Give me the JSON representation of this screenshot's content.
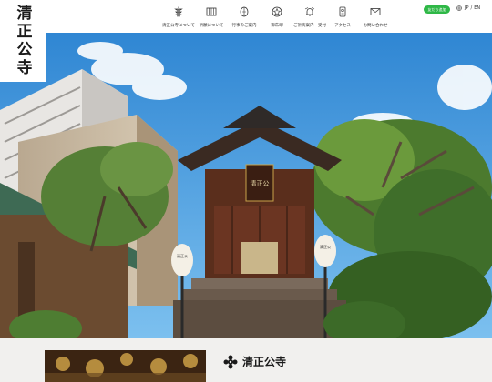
{
  "site": {
    "logo_text": "清正公寺"
  },
  "nav": {
    "items": [
      {
        "label": "清正公寺について",
        "icon": "pagoda-icon"
      },
      {
        "label": "祈願について",
        "icon": "prayer-book-icon"
      },
      {
        "label": "行事のご案内",
        "icon": "lantern-icon"
      },
      {
        "label": "御朱印",
        "icon": "seal-icon"
      },
      {
        "label": "ご祈祷案内・受付",
        "icon": "bell-icon"
      },
      {
        "label": "アクセス",
        "icon": "map-pin-icon"
      },
      {
        "label": "お問い合わせ",
        "icon": "mail-icon"
      }
    ]
  },
  "line_button": {
    "label": "友だち追加"
  },
  "language": {
    "ja": "JP",
    "separator": "/",
    "en": "EN"
  },
  "hero": {
    "lantern_left_text": "清正公",
    "lantern_right_text": "清正公",
    "plaque_text": "清正公"
  },
  "intro": {
    "title": "清正公寺"
  },
  "colors": {
    "line_green": "#2fb847",
    "sky": "#3a8fd6",
    "temple_wood": "#5a2e1c",
    "roof_patina": "#3e6a54"
  }
}
